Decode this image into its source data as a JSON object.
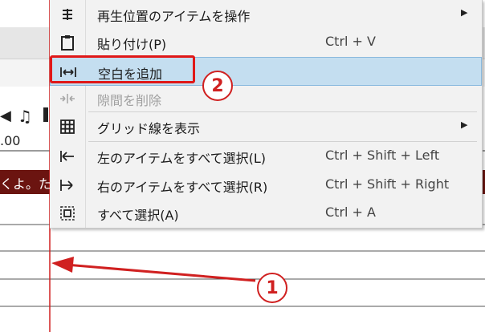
{
  "background": {
    "time_label": ".00",
    "lyric_text": "くよ。た"
  },
  "context_menu": {
    "items": [
      {
        "label": "再生位置のアイテムを操作",
        "shortcut": "",
        "submenu": true,
        "icon": "adjust-icon",
        "disabled": false,
        "highlighted": false
      },
      {
        "label": "貼り付け(P)",
        "shortcut": "Ctrl + V",
        "submenu": false,
        "icon": "clipboard-icon",
        "disabled": false,
        "highlighted": false
      },
      {
        "label": "空白を追加",
        "shortcut": "",
        "submenu": false,
        "icon": "add-space-icon",
        "disabled": false,
        "highlighted": true
      },
      {
        "label": "隙間を削除",
        "shortcut": "",
        "submenu": false,
        "icon": "remove-gap-icon",
        "disabled": true,
        "highlighted": false
      },
      {
        "label": "グリッド線を表示",
        "shortcut": "",
        "submenu": true,
        "icon": "grid-icon",
        "disabled": false,
        "highlighted": false
      },
      {
        "label": "左のアイテムをすべて選択(L)",
        "shortcut": "Ctrl + Shift + Left",
        "submenu": false,
        "icon": "select-left-icon",
        "disabled": false,
        "highlighted": false
      },
      {
        "label": "右のアイテムをすべて選択(R)",
        "shortcut": "Ctrl + Shift + Right",
        "submenu": false,
        "icon": "select-right-icon",
        "disabled": false,
        "highlighted": false
      },
      {
        "label": "すべて選択(A)",
        "shortcut": "Ctrl + A",
        "submenu": false,
        "icon": "select-all-icon",
        "disabled": false,
        "highlighted": false
      }
    ],
    "submenu_arrow": "▶"
  },
  "annotations": {
    "callout_1": "1",
    "callout_2": "2",
    "accent_color": "#d02020"
  },
  "colors": {
    "highlight": "#c4def0",
    "lyric_bar": "#6b1410",
    "playhead": "#d02020"
  }
}
